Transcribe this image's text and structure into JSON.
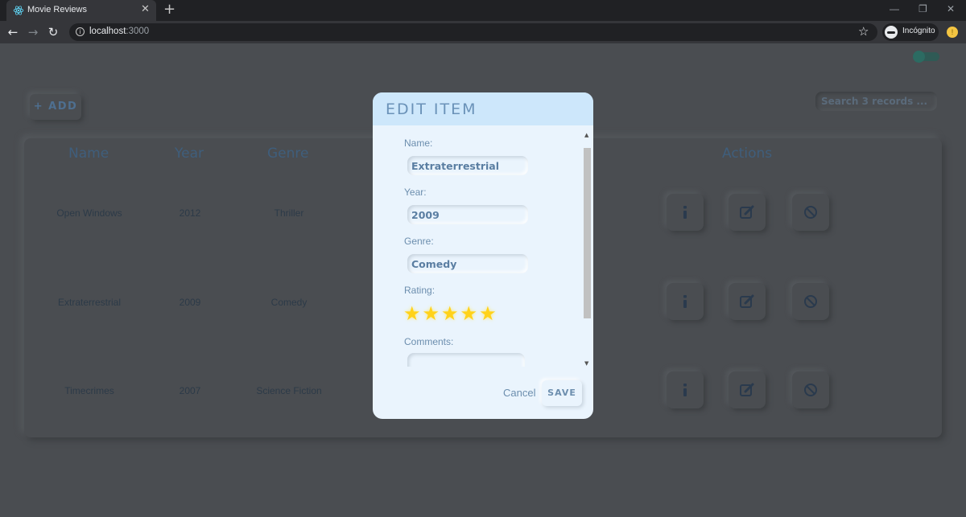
{
  "browser": {
    "tab_title": "Movie Reviews",
    "url_host": "localhost",
    "url_port": ":3000",
    "incognito_label": "Incógnito"
  },
  "toolbar": {
    "add_label": "+ ADD",
    "search_placeholder": "Search 3 records ..."
  },
  "table": {
    "headers": {
      "name": "Name",
      "year": "Year",
      "genre": "Genre",
      "actions": "Actions"
    },
    "rows": [
      {
        "name": "Open Windows",
        "year": "2012",
        "genre": "Thriller"
      },
      {
        "name": "Extraterrestrial",
        "year": "2009",
        "genre": "Comedy"
      },
      {
        "name": "Timecrimes",
        "year": "2007",
        "genre": "Science Fiction"
      }
    ]
  },
  "modal": {
    "title": "EDIT ITEM",
    "name_label": "Name:",
    "name_value": "Extraterrestrial",
    "year_label": "Year:",
    "year_value": "2009",
    "genre_label": "Genre:",
    "genre_value": "Comedy",
    "rating_label": "Rating:",
    "rating_value": 5,
    "rating_max": 5,
    "comments_label": "Comments:",
    "comments_value": "",
    "cancel_label": "Cancel",
    "save_label": "SAVE"
  },
  "icons": [
    "react-icon",
    "close-icon",
    "plus-icon",
    "back-icon",
    "forward-icon",
    "reload-icon",
    "info-icon",
    "star-icon",
    "incognito-icon",
    "info-circle-icon",
    "edit-icon",
    "ban-icon"
  ],
  "colors": {
    "accent": "#6a92b8",
    "star": "#ffd21a",
    "modal_bg": "#eaf4fd",
    "page_bg": "#4a4d51"
  }
}
